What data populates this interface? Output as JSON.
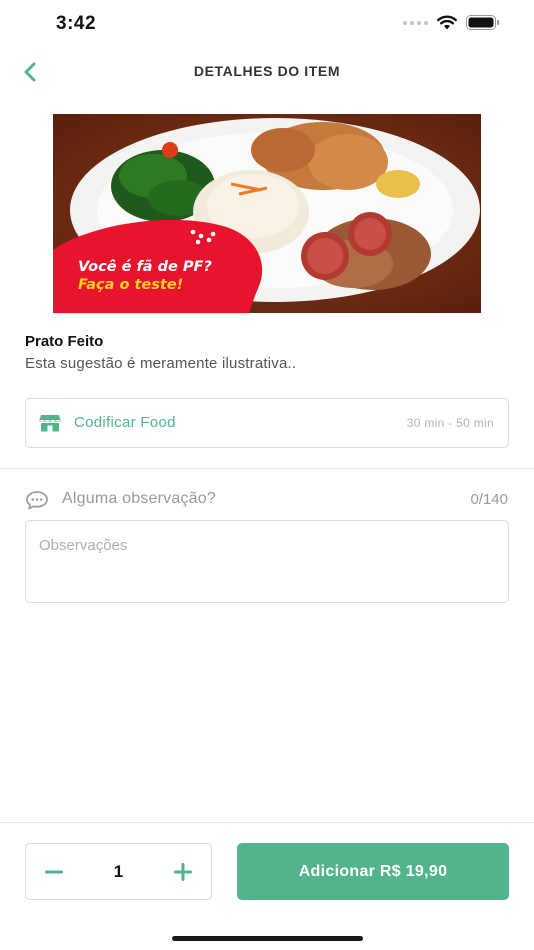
{
  "status_bar": {
    "time": "3:42"
  },
  "nav": {
    "title": "DETALHES DO ITEM",
    "back_icon": "chevron-left-icon"
  },
  "product": {
    "image_promo_line1": "Você é fã de PF?",
    "image_promo_line2": "Faça o teste!",
    "name": "Prato Feito",
    "description": "Esta sugestão é meramente ilustrativa.."
  },
  "store": {
    "icon": "store-icon",
    "name": "Codificar Food",
    "delivery_time": "30 min - 50 min"
  },
  "observations": {
    "icon": "chat-bubble-icon",
    "label": "Alguma observação?",
    "counter": "0/140",
    "placeholder": "Observações",
    "value": ""
  },
  "footer": {
    "quantity": "1",
    "minus_label": "−",
    "plus_label": "+",
    "add_button_label": "Adicionar R$ 19,90"
  },
  "colors": {
    "accent": "#52b48a",
    "promo_red": "#e8132c",
    "promo_yellow": "#ffd21e"
  }
}
